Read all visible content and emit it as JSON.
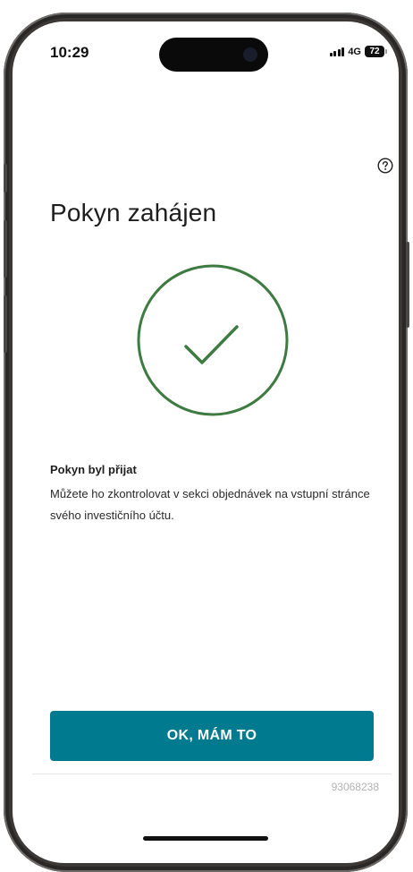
{
  "status_bar": {
    "time": "10:29",
    "network": "4G",
    "battery": "72"
  },
  "header": {
    "help_icon": "question-circle-icon"
  },
  "main": {
    "title": "Pokyn zahájen",
    "success_icon": "check-circle-icon",
    "success_color": "#3e7b40",
    "message_title": "Pokyn byl přijat",
    "message_text": "Můžete ho zkontrolovat v sekci objednávek na vstupní stránce svého investičního účtu."
  },
  "footer": {
    "ok_label": "OK, MÁM TO",
    "button_color": "#007a8e",
    "reference": "93068238"
  }
}
